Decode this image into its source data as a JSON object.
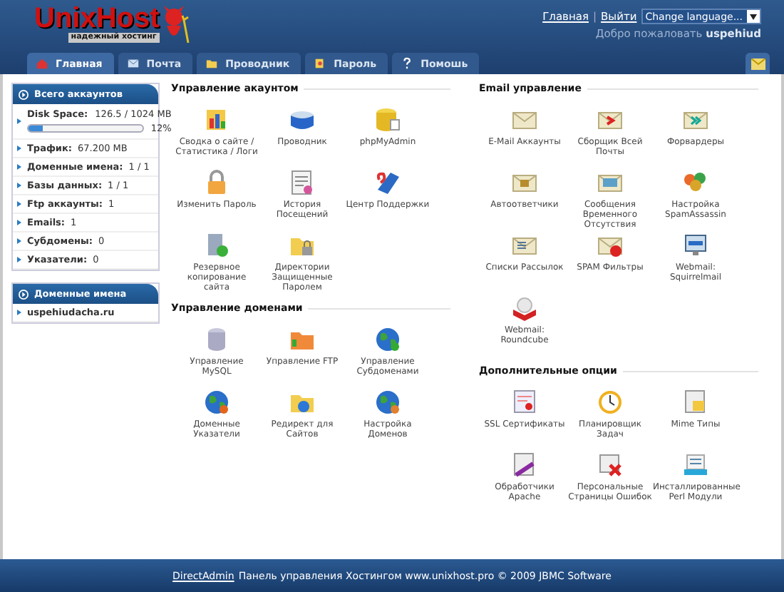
{
  "logo": {
    "name": "UnixHost",
    "tagline": "надежный хостинг"
  },
  "top_links": [
    "Главная",
    "Выйти"
  ],
  "top_links_separator": "|",
  "language_select": {
    "value": "Change language..."
  },
  "welcome": {
    "text": "Добро пожаловать",
    "user": "uspehiud"
  },
  "tabs": [
    {
      "label": "Главная",
      "selected": true
    },
    {
      "label": "Почта",
      "selected": false
    },
    {
      "label": "Проводник",
      "selected": false
    },
    {
      "label": "Пароль",
      "selected": false
    },
    {
      "label": "Помошь",
      "selected": false
    }
  ],
  "sidebar": {
    "title": "Всего аккаунтов",
    "disk": {
      "label": "Disk Space:",
      "value": "126.5 / 1024 MB",
      "level": 0.12,
      "percent": "12%"
    },
    "stats": [
      {
        "label": "Трафик:",
        "value": "67.200 MB"
      },
      {
        "label": "Доменные имена:",
        "value": "1 / 1"
      },
      {
        "label": "Базы данных:",
        "value": "1 / 1"
      },
      {
        "label": "Ftp аккаунты:",
        "value": "1"
      },
      {
        "label": "Emails:",
        "value": "1"
      },
      {
        "label": "Субдомены:",
        "value": "0"
      },
      {
        "label": "Указатели:",
        "value": "0"
      }
    ],
    "domains_title": "Доменные имена",
    "domains": [
      "uspehiudacha.ru"
    ]
  },
  "left_sections": [
    {
      "title": "Управление акаунтом",
      "items": [
        "Сводка о сайте / Статистика / Логи",
        "Проводник",
        "phpMyAdmin",
        "Изменить Пароль",
        "История Посещений",
        "Центр Поддержки",
        "Резервное копирование сайта",
        "Директории Защищенные Паролем"
      ]
    },
    {
      "title": "Управление доменами",
      "items": [
        "Управление MySQL",
        "Управление FTP",
        "Управление Субдоменами",
        "Доменные Указатели",
        "Редирект для Сайтов",
        "Настройка Доменов"
      ]
    }
  ],
  "right_sections": [
    {
      "title": "Email управление",
      "items": [
        "E-Mail Аккаунты",
        "Сборщик Всей Почты",
        "Форвардеры",
        "Автоответчики",
        "Сообщения Временного Отсутствия",
        "Настройка SpamAssassin",
        "Списки Рассылок",
        "SPAM Фильтры",
        "Webmail: Squirrelmail",
        "Webmail: Roundcube"
      ]
    },
    {
      "title": "Дополнительные опции",
      "items": [
        "SSL Сертификаты",
        "Планировщик Задач",
        "Mime Типы",
        "Обработчики Apache",
        "Персональные Страницы Ошибок",
        "Инсталлированные Perl Модули"
      ]
    }
  ],
  "footer": {
    "link": "DirectAdmin",
    "text": "Панель управления Хостингом www.unixhost.pro © 2009 JBMC Software"
  }
}
